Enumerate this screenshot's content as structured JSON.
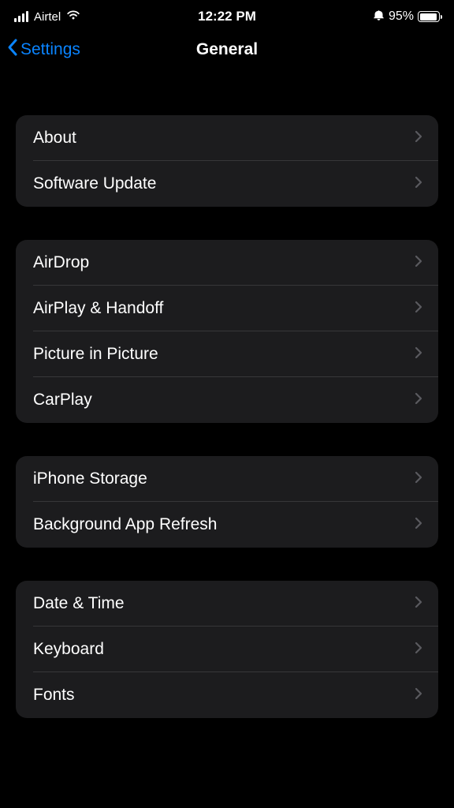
{
  "statusBar": {
    "carrier": "Airtel",
    "time": "12:22 PM",
    "batteryPercent": "95%"
  },
  "nav": {
    "back": "Settings",
    "title": "General"
  },
  "sections": [
    {
      "items": [
        {
          "label": "About"
        },
        {
          "label": "Software Update"
        }
      ]
    },
    {
      "items": [
        {
          "label": "AirDrop"
        },
        {
          "label": "AirPlay & Handoff"
        },
        {
          "label": "Picture in Picture"
        },
        {
          "label": "CarPlay"
        }
      ]
    },
    {
      "items": [
        {
          "label": "iPhone Storage"
        },
        {
          "label": "Background App Refresh"
        }
      ]
    },
    {
      "items": [
        {
          "label": "Date & Time"
        },
        {
          "label": "Keyboard"
        },
        {
          "label": "Fonts"
        }
      ]
    }
  ]
}
